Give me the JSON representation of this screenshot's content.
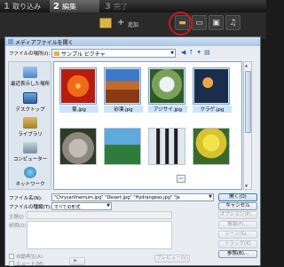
{
  "app": {
    "steps": [
      {
        "num": "1",
        "label": "取り込み"
      },
      {
        "num": "2",
        "label": "編集"
      },
      {
        "num": "3",
        "label": "完了"
      }
    ],
    "add_label": "追加",
    "accent": "#d2141c"
  },
  "dialog": {
    "title": "メディアファイルを開く",
    "look_in_label": "ファイルの場所(I):",
    "look_in_value": "サンプル ピクチャ",
    "places": [
      {
        "label": "最近表示した場所",
        "icon": "recent-places-icon"
      },
      {
        "label": "デスクトップ",
        "icon": "desktop-icon"
      },
      {
        "label": "ライブラリ",
        "icon": "library-icon"
      },
      {
        "label": "コンピューター",
        "icon": "computer-icon"
      },
      {
        "label": "ネットワーク",
        "icon": "network-icon"
      }
    ],
    "files": [
      {
        "name": "菊.jpg",
        "selected": true
      },
      {
        "name": "砂漠.jpg",
        "selected": true
      },
      {
        "name": "アジサイ.jpg",
        "selected": true
      },
      {
        "name": "クラゲ.jpg",
        "selected": true
      },
      {
        "name": "",
        "selected": false
      },
      {
        "name": "",
        "selected": false
      },
      {
        "name": "",
        "selected": false
      },
      {
        "name": "",
        "selected": false
      }
    ],
    "filename_label": "ファイル名(N):",
    "filename_value": "\"Chrysanthemum.jpg\" \"Desert.jpg\" \"Hydrangeas.jpg\" \"Je",
    "filetype_label": "ファイルの種類(T):",
    "filetype_value": "すべての形式",
    "subject_label": "主題(J)",
    "description_label": "説明(D)",
    "buttons": {
      "open": "開く(O)",
      "cancel": "キャンセル",
      "options": "オプション(P)...",
      "info": "情報(F)...",
      "scene": "シーン(S)...",
      "browse": "参照(B)...",
      "track": "トラック(K)",
      "preview": "プレビュー(V)"
    },
    "checks": {
      "auto_play": "自動再生(A)",
      "mute": "ミュート(M)"
    }
  }
}
